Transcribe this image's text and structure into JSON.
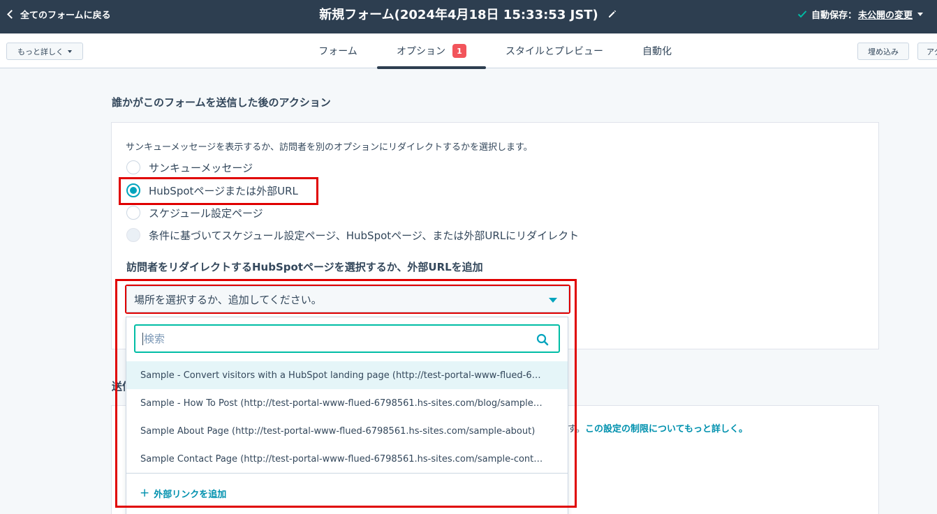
{
  "topbar": {
    "back_label": "全てのフォームに戻る",
    "title": "新規フォーム(2024年4月18日 15:33:53 JST)",
    "autosave_label": "自動保存：",
    "autosave_link": "未公開の変更"
  },
  "tabbar": {
    "more_label": "もっと詳しく",
    "tabs": [
      {
        "label": "フォーム"
      },
      {
        "label": "オプション",
        "badge": "1"
      },
      {
        "label": "スタイルとプレビュー"
      },
      {
        "label": "自動化"
      }
    ],
    "embed_label": "埋め込み",
    "cut_label": "アク"
  },
  "actions": {
    "heading": "誰かがこのフォームを送信した後のアクション",
    "description": "サンキューメッセージを表示するか、訪問者を別のオプションにリダイレクトするかを選択します。",
    "options": [
      {
        "label": "サンキューメッセージ",
        "checked": false
      },
      {
        "label": "HubSpotページまたは外部URL",
        "checked": true
      },
      {
        "label": "スケジュール設定ページ",
        "checked": false
      },
      {
        "label": "条件に基づいてスケジュール設定ページ、HubSpotページ、または外部URLにリダイレクト",
        "checked": false,
        "disabled": true
      }
    ],
    "redirect_heading": "訪問者をリダイレクトするHubSpotページを選択するか、外部URLを追加",
    "select_placeholder": "場所を選択するか、追加してください。"
  },
  "dropdown": {
    "search_placeholder": "検索",
    "options": [
      "Sample - Convert visitors with a HubSpot landing page (http://test-portal-www-flued-6…",
      "Sample - How To Post (http://test-portal-www-flued-6798561.hs-sites.com/blog/sample…",
      "Sample About Page (http://test-portal-www-flued-6798561.hs-sites.com/sample-about)",
      "Sample Contact Page (http://test-portal-www-flued-6798561.hs-sites.com/sample-cont…"
    ],
    "add_link": "外部リンクを追加"
  },
  "panel2": {
    "heading": "送信",
    "tail_text": "す。",
    "link": "この設定の制限についてもっと詳しく。"
  },
  "colors": {
    "topbar": "#2d3e50",
    "accent": "#00a4bd",
    "link": "#0091ae",
    "badge": "#f2545b",
    "highlight": "#e00000"
  }
}
